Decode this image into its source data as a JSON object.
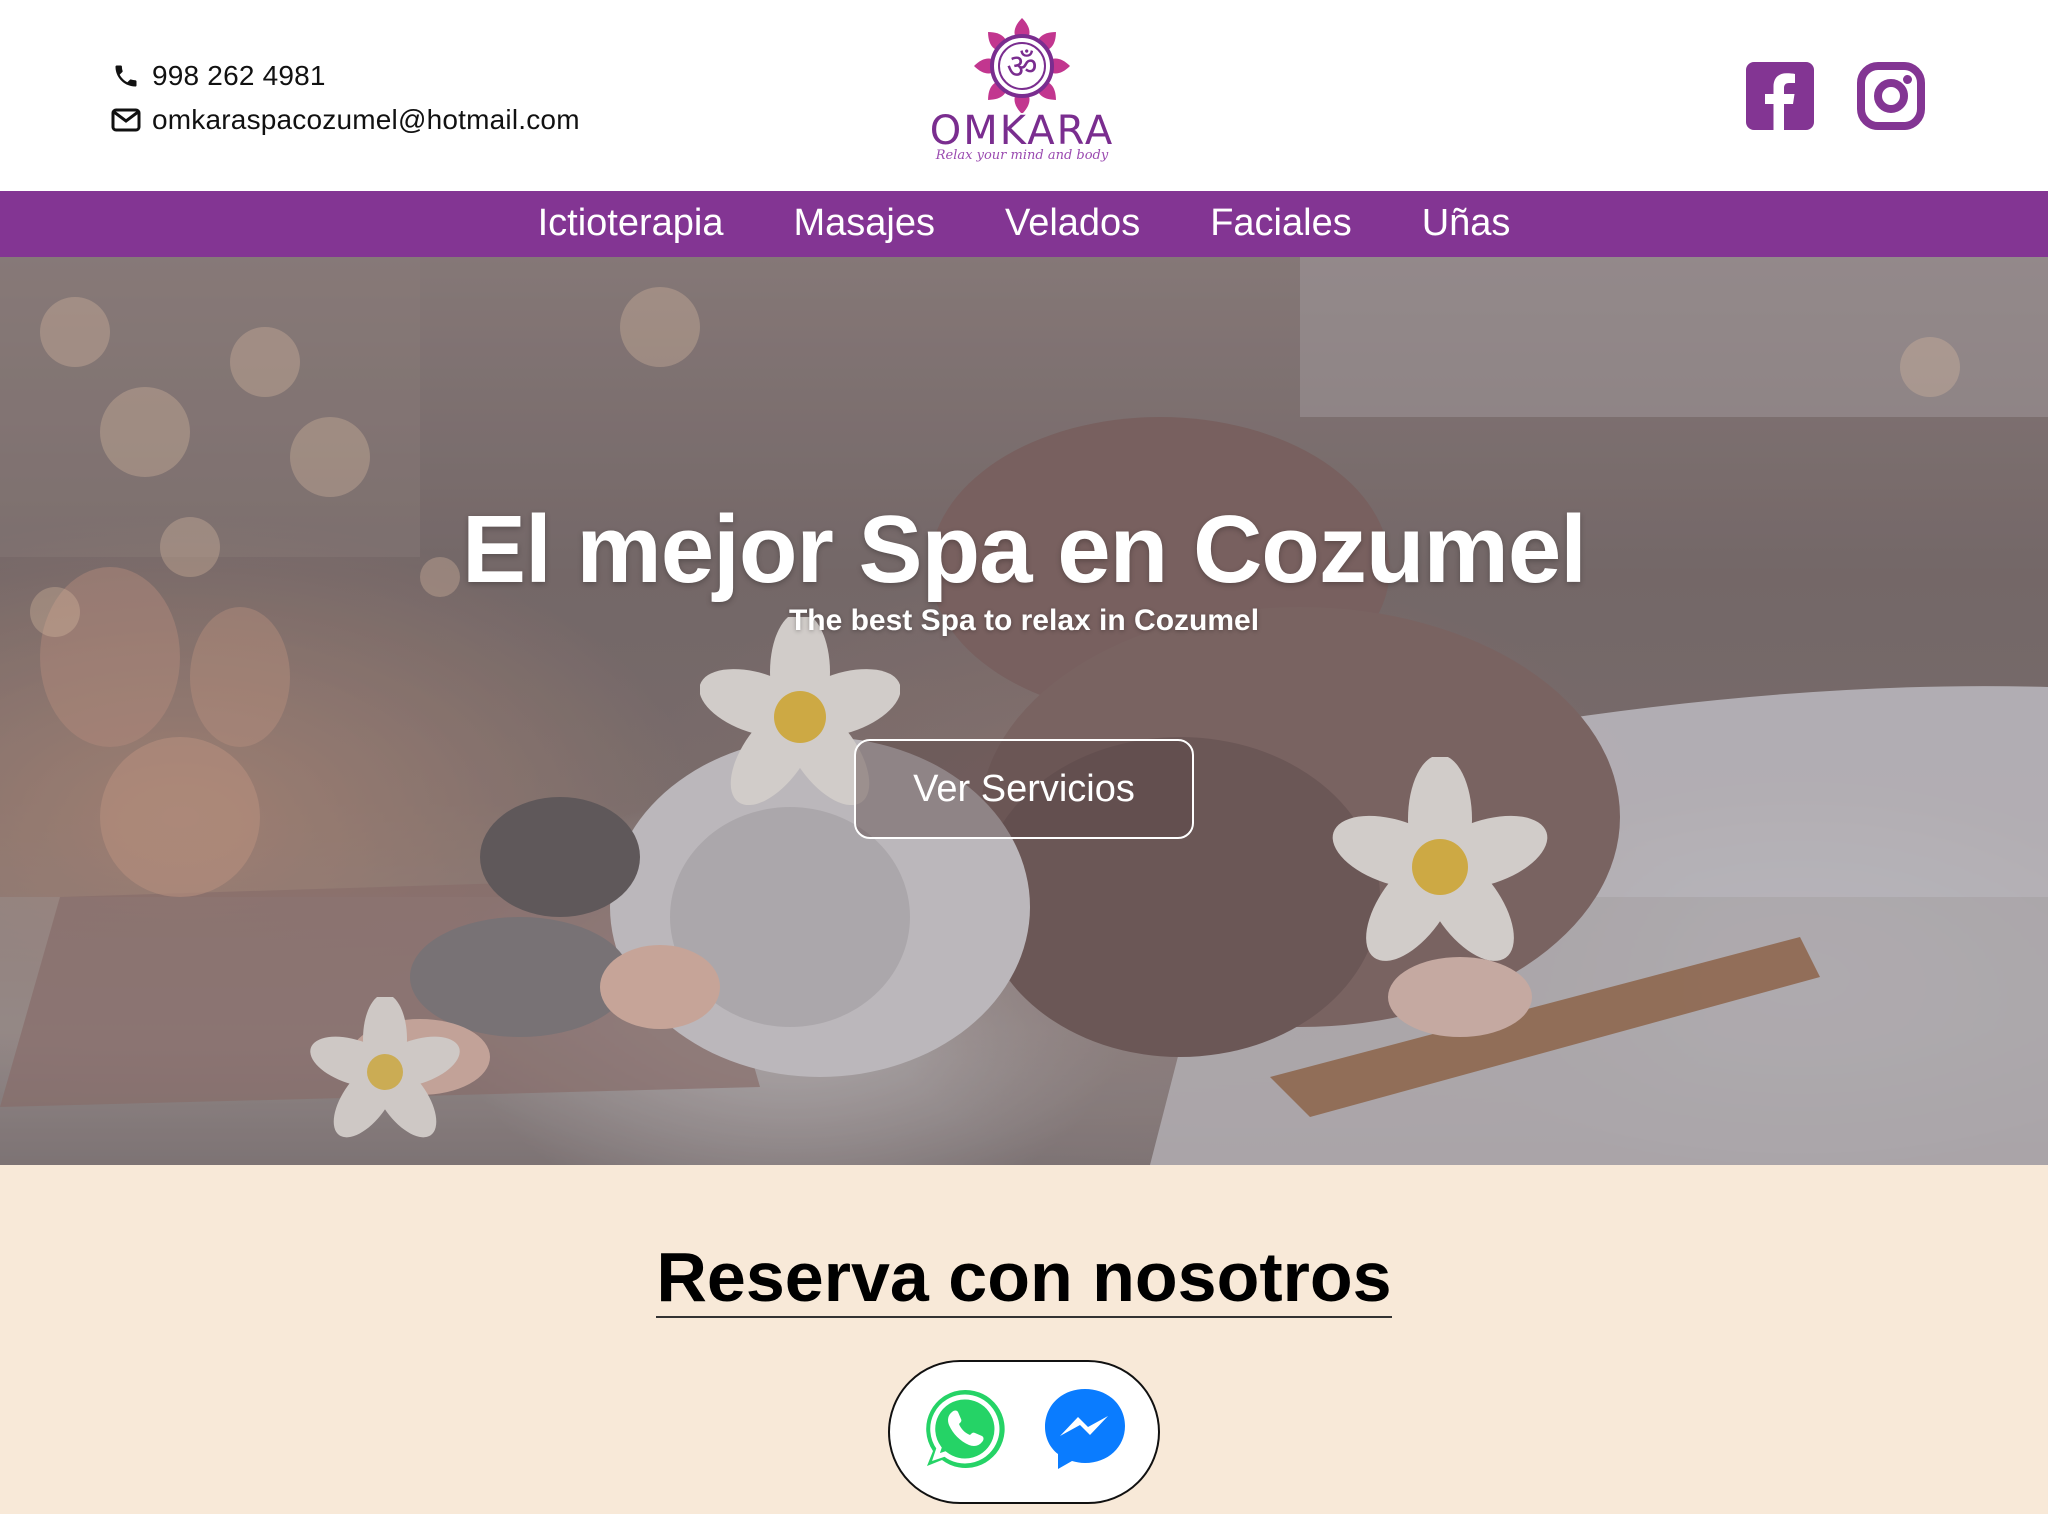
{
  "header": {
    "phone": "998 262 4981",
    "email": "omkaraspacozumel@hotmail.com",
    "logo": {
      "name": "OMKARA",
      "tagline": "Relax your mind and body",
      "color": "#7a2d8f"
    },
    "social": [
      {
        "icon": "facebook-icon",
        "color": "#833593"
      },
      {
        "icon": "instagram-icon",
        "color": "#833593"
      }
    ]
  },
  "nav": {
    "background": "#833593",
    "items": [
      "Ictioterapia",
      "Masajes",
      "Velados",
      "Faciales",
      "Uñas"
    ]
  },
  "hero": {
    "title": "El mejor Spa en Cozumel",
    "subtitle": "The best Spa to relax in Cozumel",
    "button": "Ver Servicios"
  },
  "reserve": {
    "title": "Reserva con nosotros",
    "background": "#f8e9d8",
    "contacts": [
      {
        "icon": "whatsapp-icon",
        "color": "#25d366"
      },
      {
        "icon": "messenger-icon",
        "color": "#0a7cff"
      }
    ]
  }
}
